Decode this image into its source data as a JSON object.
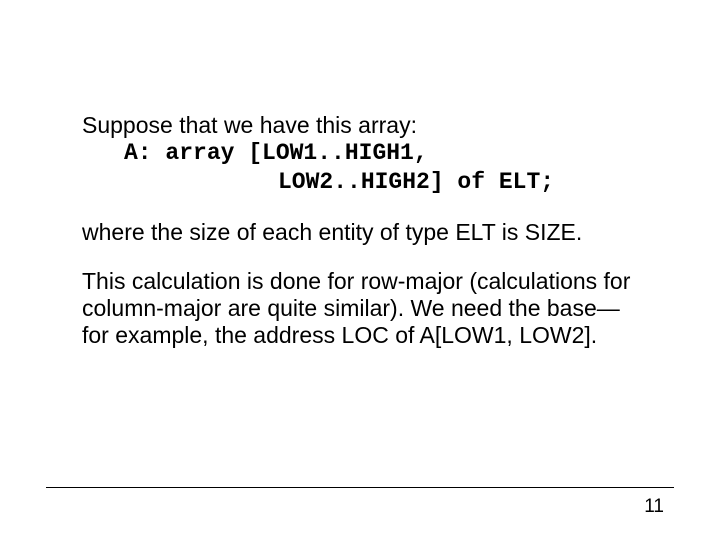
{
  "content": {
    "intro": "Suppose that we have this array:",
    "code1": "A: array [LOW1..HIGH1,",
    "code2": "LOW2..HIGH2] of ELT;",
    "para1": "where the size of each entity of type ELT is SIZE.",
    "para2": "This calculation is done for row-major (calculations for column-major are quite similar). We need the base—for example, the address LOC of A[LOW1, LOW2]."
  },
  "page_number": "11"
}
